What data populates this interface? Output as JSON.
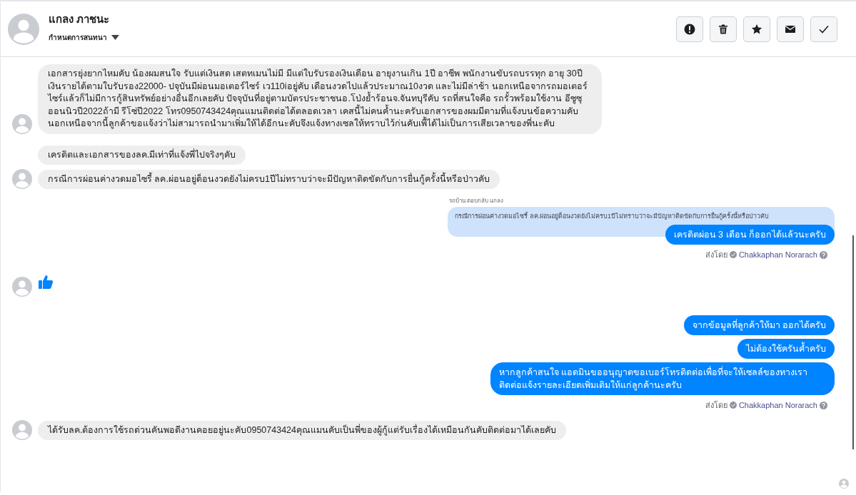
{
  "header": {
    "name": "แกลง ภาชนะ",
    "subtitle": "กำหนดการสนทนา",
    "actions": [
      {
        "kind": "alert"
      },
      {
        "kind": "trash"
      },
      {
        "kind": "star"
      },
      {
        "kind": "mail"
      },
      {
        "kind": "check"
      }
    ]
  },
  "messages": [
    {
      "kind": "in",
      "text": "เอกสารยุ่งยากไหมคับ น้องผมสนใจ  รับแต่เงินสด เสตทเมนไม่มี มีแต่ใบรับรองเงินเดือน อายุงานเกิน 1ปี อาชีพ พนักงานขับรถบรรทุก อายุ 30ปี  เงินรายได้ตามใบรับรอง22000- ปจุบันมีผ่อนมอเตอร์ไซร์ เว110iอยู่คับ  เดือนงวดไปแล้วประมาณ10งวด  และไม่มีล่าช้า นอกเหนือจากรถมอเตอร์ไซร์แล้วก็ไม่มีการกู้สินทรัพย์อย่างอื่นอีกเลยคับ    ปัจจุบันที่อยู่ตามบัตรประชาชนอ.โป่งย้ำร้อนจ.จันทบุรีคับ รถที่สนใจคือ รถรั้วพร้อมใช้งาน อีซูซุออนนิวปี2022ถ้ามี  รีโซ่ปี2022  โทร0950743424คุณแมนติดต่อได้ตลอดเวลา เคสนี้ไม่คนค้ำนะครับเอกสารของผมมีตามที่แจ้งบนข้อความคับนอกเหนือจากนี้ลูกค้าขอแจ้งว่าไม่สามารถนำมาเพิ่มให้ได้อีกนะคับจึงแจ้งทางเซลให้ทราบไว้ก่นคับเพื้ได้ไม่เป็นการเสียเวลาของพี่นะคับ",
      "avatar": true
    },
    {
      "kind": "in",
      "text": "เครดิตและเอกสารของลค.มีเท่าที่แจ้งพี่ไปจริงๆคับ",
      "avatar": false
    },
    {
      "kind": "in",
      "text": "กรณีการผ่อนค่างวดมอไซรี้ ลค.ผ่อนอยู่ด็อนงวดยังไม่ครบ1ปีไม่ทราบว่าจะมีปัญหาติดขัดกับการยื่นกู้ครั้งนี้หรือป่าวคับ",
      "avatar": true
    },
    {
      "kind": "reply_label",
      "text": "รถบ้าน ตอบกลับ แกลง"
    },
    {
      "kind": "quote",
      "text": "กรณีการผ่อนค่างวดมอไซรี้ ลค.ผ่อนอยู่ด็อนงวดยังไม่ครบ1ปีไม่ทราบว่าจะมีปัญหาติดขัดกับการยื่นกู้ครั้งนี้หรือป่าวคับ"
    },
    {
      "kind": "out",
      "text": "เครดิตผ่อน 3 เดือน ก็ออกได้แล้วนะครับ"
    },
    {
      "kind": "sent_by",
      "label": "ส่งโดย",
      "name": "Chakkaphan Norarach"
    },
    {
      "kind": "like",
      "avatar": true
    },
    {
      "kind": "out",
      "text": "จากข้อมูลที่ลูกค้าให้มา ออกได้ครับ"
    },
    {
      "kind": "out",
      "text": "ไม่ต้องใช้ครันค้ำครับ"
    },
    {
      "kind": "out",
      "text": "หากลูกค้าสนใจ แอดมินขออนุญาตขอเบอร์โทรติดต่อเพื่อที่จะให้เซลล์ของทางเราติดต่อแจ้งรายละเอียดเพิ่มเติมให้แก่ลูกค้านะครับ"
    },
    {
      "kind": "sent_by",
      "label": "ส่งโดย",
      "name": "Chakkaphan Norarach"
    },
    {
      "kind": "in",
      "text": "ได้รับลค.ต้องการใช้รถด่วนคันพอดีงานคอยอยู่นะคับ0950743424คุณแมนคับเป็นพี่ของผู้กู้แต่รับเรื่องได้เหมือนกันคับติดต่อมาได้เลยคับ",
      "avatar": true
    }
  ]
}
